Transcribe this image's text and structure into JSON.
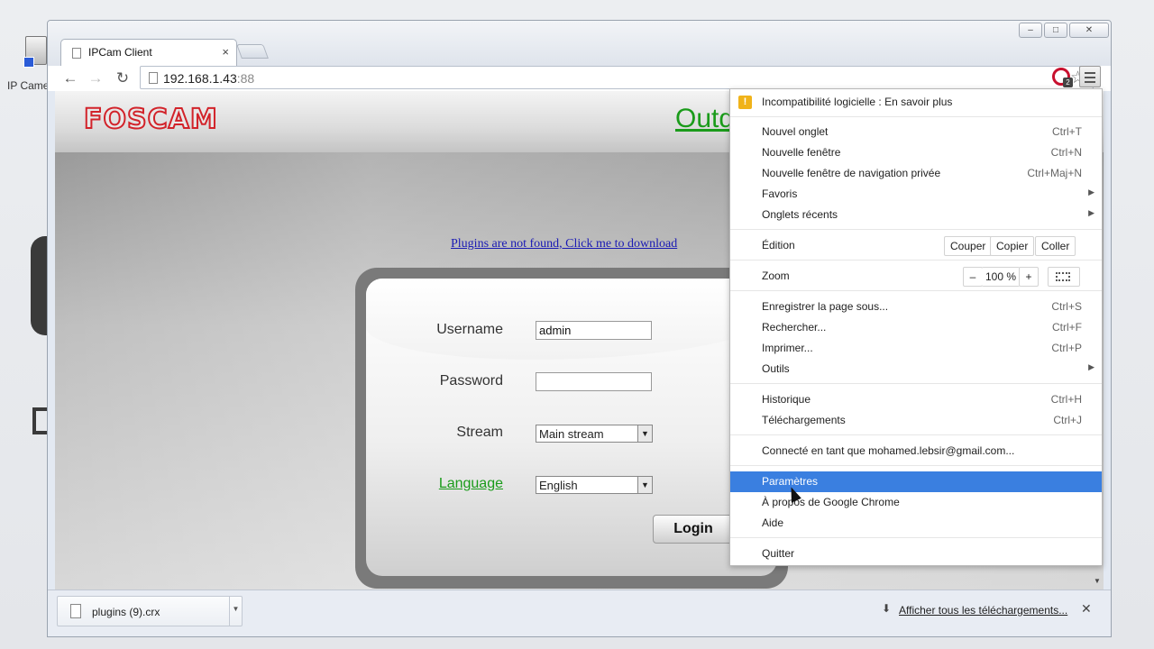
{
  "desktop": {
    "icon_label": "IP Came"
  },
  "browser": {
    "tab_title": "IPCam Client",
    "tab_close": "×",
    "url_host": "192.168.1.43",
    "url_port": ":88",
    "controls": {
      "minimize": "–",
      "maximize": "□",
      "close": "✕"
    },
    "extension_badge": "2"
  },
  "page": {
    "brand": "FOSCAM",
    "header_link": "Outd",
    "plugin_link": "Plugins are not found, Click me to download",
    "form": {
      "username_label": "Username",
      "username_value": "admin",
      "password_label": "Password",
      "password_value": "",
      "stream_label": "Stream",
      "stream_value": "Main stream",
      "language_label": "Language",
      "language_value": "English",
      "login_button": "Login"
    }
  },
  "menu": {
    "warning": "Incompatibilité logicielle : En savoir plus",
    "items_group1": [
      {
        "label": "Nouvel onglet",
        "shortcut": "Ctrl+T"
      },
      {
        "label": "Nouvelle fenêtre",
        "shortcut": "Ctrl+N"
      },
      {
        "label": "Nouvelle fenêtre de navigation privée",
        "shortcut": "Ctrl+Maj+N"
      },
      {
        "label": "Favoris",
        "submenu": true
      },
      {
        "label": "Onglets récents",
        "submenu": true
      }
    ],
    "edit": {
      "label": "Édition",
      "cut": "Couper",
      "copy": "Copier",
      "paste": "Coller"
    },
    "zoom": {
      "label": "Zoom",
      "minus": "–",
      "value": "100 %",
      "plus": "+"
    },
    "items_group2": [
      {
        "label": "Enregistrer la page sous...",
        "shortcut": "Ctrl+S"
      },
      {
        "label": "Rechercher...",
        "shortcut": "Ctrl+F"
      },
      {
        "label": "Imprimer...",
        "shortcut": "Ctrl+P"
      },
      {
        "label": "Outils",
        "submenu": true
      }
    ],
    "items_group3": [
      {
        "label": "Historique",
        "shortcut": "Ctrl+H"
      },
      {
        "label": "Téléchargements",
        "shortcut": "Ctrl+J"
      }
    ],
    "signed_in": "Connecté en tant que mohamed.lebsir@gmail.com...",
    "settings": "Paramètres",
    "about": "À propos de Google Chrome",
    "help": "Aide",
    "quit": "Quitter"
  },
  "downloads": {
    "file_name": "plugins (9).crx",
    "show_all": "Afficher tous les téléchargements...",
    "close": "✕"
  }
}
